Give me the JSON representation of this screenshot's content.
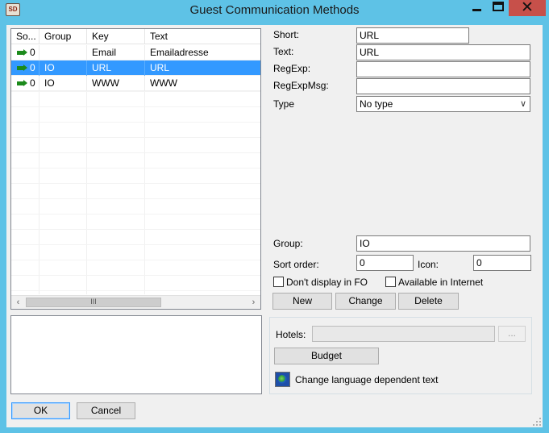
{
  "window": {
    "title": "Guest Communication Methods",
    "app_icon_text": "SD"
  },
  "grid": {
    "columns": [
      "So...",
      "Group",
      "Key",
      "Text"
    ],
    "rows": [
      {
        "sort": "0",
        "group": "",
        "key": "Email",
        "text": "Emailadresse",
        "selected": false
      },
      {
        "sort": "0",
        "group": "IO",
        "key": "URL",
        "text": "URL",
        "selected": true
      },
      {
        "sort": "0",
        "group": "IO",
        "key": "WWW",
        "text": "WWW",
        "selected": false
      }
    ],
    "scroll_thumb_label": "III"
  },
  "form": {
    "short_label": "Short:",
    "short_value": "URL",
    "text_label": "Text:",
    "text_value": "URL",
    "regexp_label": "RegExp:",
    "regexp_value": "",
    "regexpmsg_label": "RegExpMsg:",
    "regexpmsg_value": "",
    "type_label": "Type",
    "type_value": "No type",
    "group_label": "Group:",
    "group_value": "IO",
    "sort_order_label": "Sort order:",
    "sort_order_value": "0",
    "icon_label": "Icon:",
    "icon_value": "0",
    "dont_display_label": "Don't display in FO",
    "available_internet_label": "Available in Internet"
  },
  "actions": {
    "new_label": "New",
    "change_label": "Change",
    "delete_label": "Delete"
  },
  "hotels": {
    "hotels_label": "Hotels:",
    "hotels_value": "",
    "browse_label": "...",
    "budget_label": "Budget",
    "change_lang_label": "Change language dependent text"
  },
  "footer": {
    "ok_label": "OK",
    "cancel_label": "Cancel"
  },
  "colors": {
    "title_bar": "#5ec2e6",
    "selection": "#3399ff",
    "close_button": "#c7504a",
    "arrow": "#1b8a1b"
  }
}
